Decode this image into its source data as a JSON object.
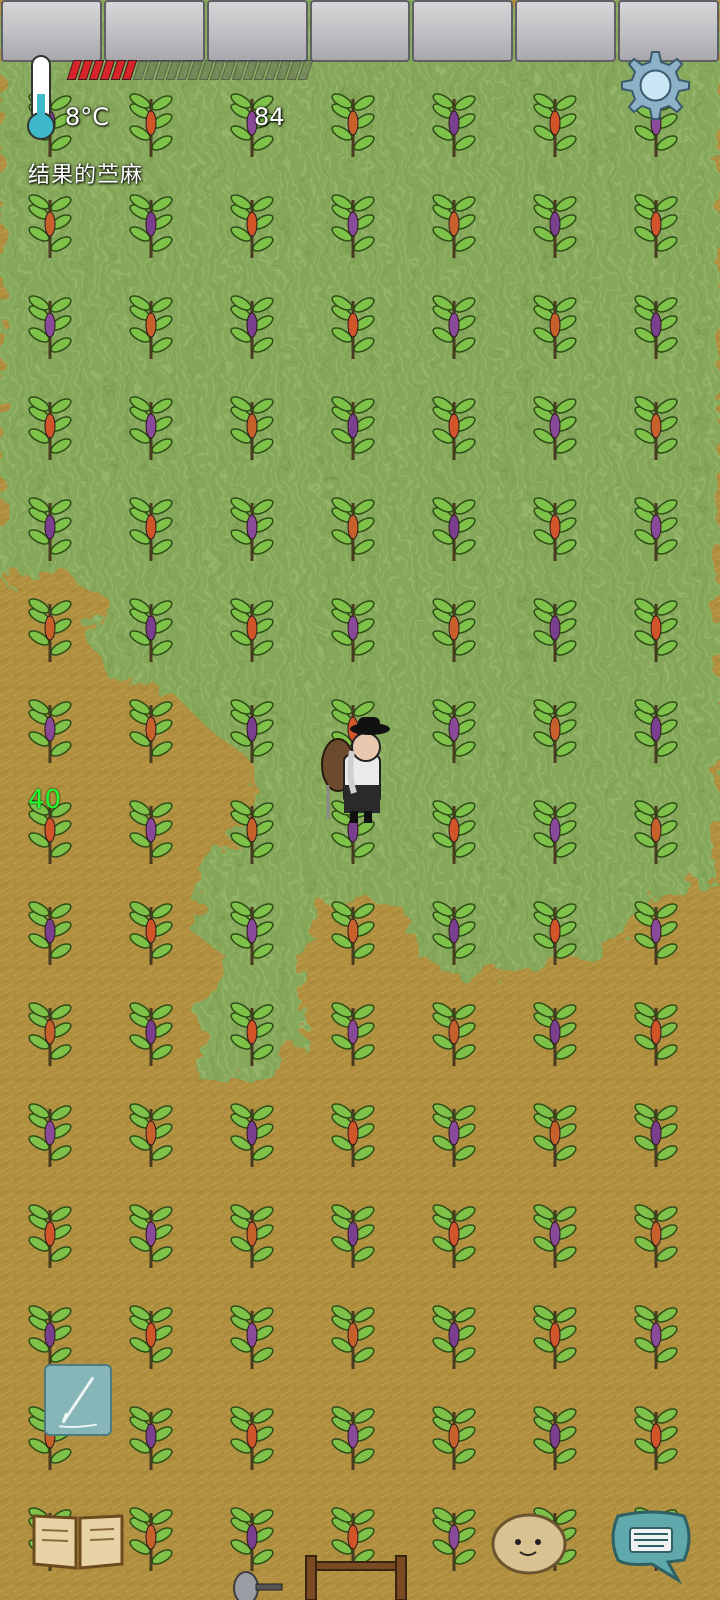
{
  "hud": {
    "temperature": "8°C",
    "yum_counter": "84",
    "hovered_object": "结果的苎麻",
    "age": "40",
    "food_bar": {
      "filled": 6,
      "total": 22
    }
  },
  "icons": {
    "thermometer": "thermometer-icon",
    "settings": "gear-icon",
    "write": "pencil-icon",
    "journal": "book-icon",
    "emote": "smiley-potato-icon",
    "keyboard": "keyboard-icon"
  },
  "colors": {
    "food_full": "#d6242a",
    "age_text": "#21ff2e",
    "grass": "#86a85a",
    "dirt": "#b08f45"
  },
  "field": {
    "rows": 15,
    "cols": 7,
    "plant": "milkweed"
  }
}
